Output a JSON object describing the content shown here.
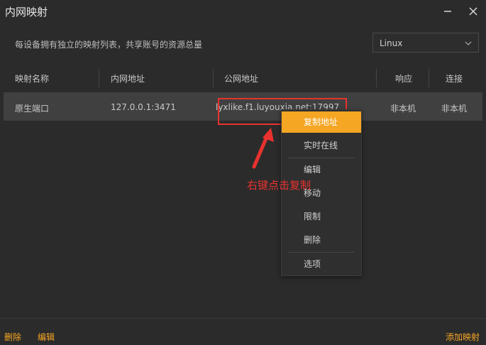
{
  "window": {
    "title": "内网映射"
  },
  "header": {
    "description": "每设备拥有独立的映射列表，共享账号的资源总量"
  },
  "os_select": {
    "value": "Linux"
  },
  "table": {
    "columns": [
      "映射名称",
      "内网地址",
      "公网地址",
      "响应",
      "连接"
    ],
    "rows": [
      {
        "name": "原生端口",
        "internal": "127.0.0.1:3471",
        "public": "lyxlike.f1.luyouxia.net:17997",
        "response": "非本机",
        "connection": "非本机"
      }
    ]
  },
  "context_menu": {
    "items": [
      {
        "label": "复制地址",
        "active": true
      },
      {
        "label": "实时在线"
      },
      {
        "label": "编辑"
      },
      {
        "label": "移动"
      },
      {
        "label": "限制"
      },
      {
        "label": "删除"
      },
      {
        "label": "选项"
      }
    ]
  },
  "annotation": {
    "text": "右键点击复制",
    "color": "#e8322f"
  },
  "footer": {
    "delete_label": "删除",
    "edit_label": "编辑",
    "add_label": "添加映射"
  },
  "colors": {
    "accent": "#f5a623",
    "background": "#2b2b2b",
    "row_highlight": "#404040",
    "annotation": "#e8322f"
  }
}
